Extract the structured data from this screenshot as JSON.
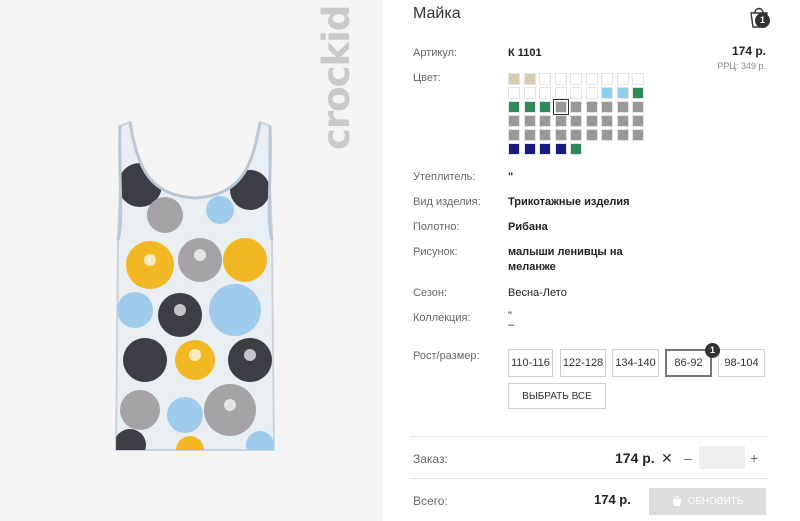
{
  "brand": {
    "logo_text": "crockid"
  },
  "product": {
    "title": "Майка",
    "article_label": "Артикул:",
    "article_value": "К 1101",
    "price": "174 р.",
    "rrp": "РРЦ: 349 р.",
    "color_label": "Цвет:",
    "swatches": [
      "#d7cbb0",
      "#d7cbb0",
      "#ffffff",
      "#ffffff",
      "#ffffff",
      "#ffffff",
      "#ffffff",
      "#ffffff",
      "#ffffff",
      "#ffffff",
      "#ffffff",
      "#ffffff",
      "#ffffff",
      "#ffffff",
      "#ffffff",
      "#8fd0f2",
      "#8fd0f2",
      "#2e8b57",
      "#2e8b57",
      "#2e8b57",
      "#2e8b57",
      "#999999",
      "#999999",
      "#999999",
      "#999999",
      "#999999",
      "#999999",
      "#999999",
      "#999999",
      "#999999",
      "#999999",
      "#999999",
      "#999999",
      "#999999",
      "#999999",
      "#999999",
      "#999999",
      "#999999",
      "#999999",
      "#999999",
      "#999999",
      "#999999",
      "#999999",
      "#999999",
      "#999999",
      "#1a1a7a",
      "#1a1a7a",
      "#1a1a7a",
      "#1a1a7a",
      "#2e8b57"
    ],
    "selected_swatch_index": 21,
    "insulation_label": "Утеплитель:",
    "insulation_value": "\"",
    "kind_label": "Вид изделия:",
    "kind_value": "Трикотажные изделия",
    "fabric_label": "Полотно:",
    "fabric_value": "Рибана",
    "pattern_label": "Рисунок:",
    "pattern_value_line1": "малыши ленивцы на",
    "pattern_value_line2": "меланже",
    "season_label": "Сезон:",
    "season_value": "Весна-Лето",
    "collection_label": "Коллекция:",
    "collection_value_line1": "\"",
    "collection_value_line2": "–",
    "size_label": "Рост/размер:",
    "sizes": [
      "110-116",
      "122-128",
      "134-140",
      "86-92",
      "98-104"
    ],
    "active_size": "86-92",
    "size_badge": "1",
    "select_all": "ВЫБРАТЬ ВСЕ"
  },
  "cart": {
    "badge": "1",
    "icon": "shopping-bag-icon"
  },
  "order": {
    "label": "Заказ:",
    "price": "174 р.",
    "times": "✕",
    "minus": "–",
    "quantity": "",
    "plus": "+"
  },
  "total": {
    "label": "Всего:",
    "price": "174 р.",
    "update_button": "ОБНОВИТЬ"
  },
  "colors": {
    "yellow": "#f2b824",
    "blue": "#9fcbec",
    "dark": "#3d3d45",
    "grey": "#a6a3a6",
    "shirt": "#e9eef3"
  }
}
